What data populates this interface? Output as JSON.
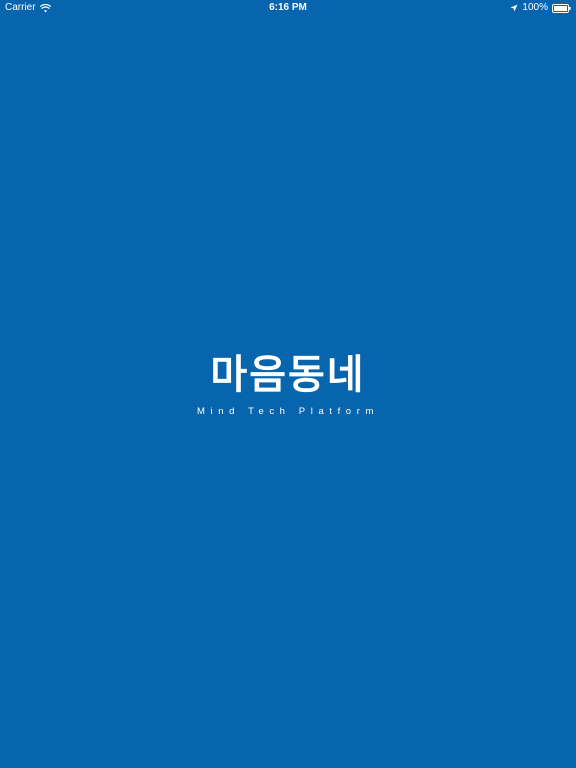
{
  "status_bar": {
    "carrier": "Carrier",
    "time": "6:16 PM",
    "battery": "100%",
    "icons": [
      "wifi-icon",
      "location-icon",
      "battery-icon"
    ]
  },
  "splash": {
    "logo_text": "마음동네",
    "tagline": "Mind Tech Platform"
  },
  "colors": {
    "background": "#0765AD",
    "text": "#FFFFFF"
  }
}
